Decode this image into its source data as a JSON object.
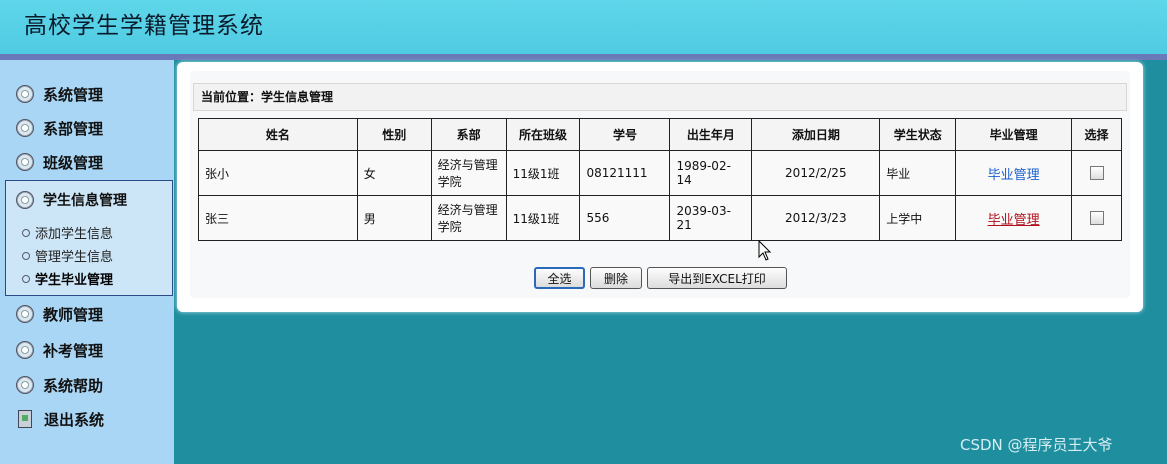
{
  "header": {
    "title": "高校学生学籍管理系统"
  },
  "sidebar": {
    "items": [
      {
        "label": "系统管理",
        "icon": "disc-icon"
      },
      {
        "label": "系部管理",
        "icon": "disc-icon"
      },
      {
        "label": "班级管理",
        "icon": "disc-icon"
      },
      {
        "label": "学生信息管理",
        "icon": "disc-icon"
      },
      {
        "label": "教师管理",
        "icon": "disc-icon"
      },
      {
        "label": "补考管理",
        "icon": "disc-icon"
      },
      {
        "label": "系统帮助",
        "icon": "disc-icon"
      },
      {
        "label": "退出系统",
        "icon": "exit-door-icon"
      }
    ],
    "subitems": [
      {
        "label": "添加学生信息"
      },
      {
        "label": "管理学生信息"
      },
      {
        "label": "学生毕业管理"
      }
    ]
  },
  "main": {
    "breadcrumb": "当前位置：学生信息管理",
    "columns": [
      "姓名",
      "性别",
      "系部",
      "所在班级",
      "学号",
      "出生年月",
      "添加日期",
      "学生状态",
      "毕业管理",
      "选择"
    ],
    "rows": [
      {
        "name": "张小",
        "gender": "女",
        "dept": "经济与管理学院",
        "class": "11级1班",
        "id": "08121111",
        "birth": "1989-02-14",
        "added": "2012/2/25",
        "status": "毕业",
        "action": "毕业管理"
      },
      {
        "name": "张三",
        "gender": "男",
        "dept": "经济与管理学院",
        "class": "11级1班",
        "id": "556",
        "birth": "2039-03-21",
        "added": "2012/3/23",
        "status": "上学中",
        "action": "毕业管理"
      }
    ],
    "buttons": {
      "select_all": "全选",
      "delete": "删除",
      "export": "导出到EXCEL打印"
    }
  },
  "watermark": "CSDN @程序员王大爷",
  "colors": {
    "header": "#55d0e6",
    "sidebar": "#a9d6f5",
    "background": "#1f8fa0",
    "link_blue": "#1a5fd0",
    "link_red": "#b0101a"
  }
}
